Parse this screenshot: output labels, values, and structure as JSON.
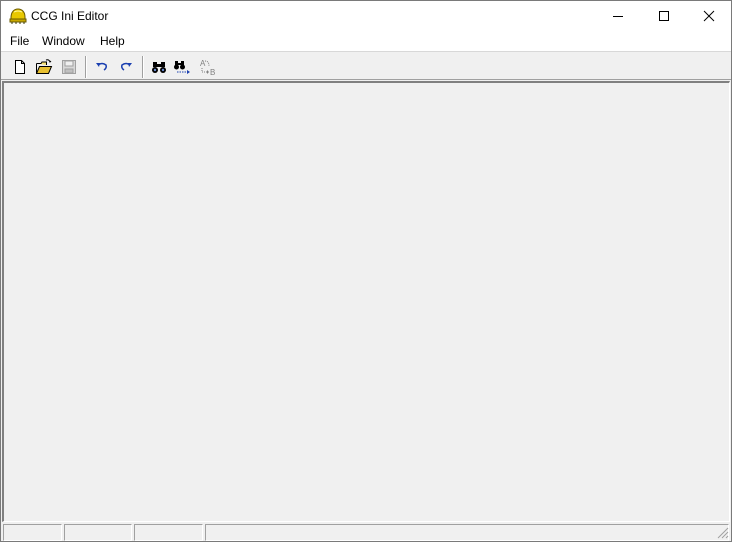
{
  "window": {
    "title": "CCG Ini Editor",
    "icon": "app-helmet-icon"
  },
  "caption_buttons": {
    "minimize": "minimize-icon",
    "maximize": "maximize-icon",
    "close": "close-icon"
  },
  "menu": {
    "items": [
      {
        "label": "File"
      },
      {
        "label": "Window"
      },
      {
        "label": "Help"
      }
    ]
  },
  "toolbar": {
    "buttons": [
      {
        "icon": "new-document-icon",
        "enabled": true
      },
      {
        "icon": "open-folder-icon",
        "enabled": true
      },
      {
        "icon": "save-disk-icon",
        "enabled": false
      },
      {
        "icon": "undo-icon",
        "enabled": true
      },
      {
        "icon": "redo-icon",
        "enabled": true
      },
      {
        "icon": "find-binoculars-icon",
        "enabled": true
      },
      {
        "icon": "find-next-icon",
        "enabled": true
      },
      {
        "icon": "replace-icon",
        "enabled": false
      }
    ]
  },
  "statusbar": {
    "panes": [
      "",
      "",
      "",
      ""
    ]
  },
  "colors": {
    "window_bg": "#f0f0f0",
    "titlebar_bg": "#ffffff",
    "accent_blue": "#1a3fb0"
  }
}
